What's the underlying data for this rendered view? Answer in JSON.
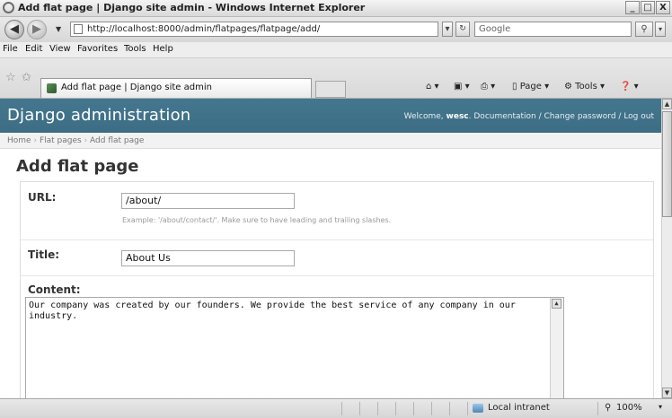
{
  "window": {
    "title": "Add flat page | Django site admin - Windows Internet Explorer",
    "controls": [
      "_",
      "□",
      "X"
    ]
  },
  "address_bar": {
    "url": "http://localhost:8000/admin/flatpages/flatpage/add/",
    "search_placeholder": "Google"
  },
  "menu": {
    "items": [
      "File",
      "Edit",
      "View",
      "Favorites",
      "Tools",
      "Help"
    ]
  },
  "tab": {
    "label": "Add flat page | Django site admin"
  },
  "command_bar": {
    "page_label": "Page",
    "tools_label": "Tools"
  },
  "django": {
    "brand": "Django administration",
    "welcome_prefix": "Welcome, ",
    "username": "wesc",
    "user_links": ". Documentation / Change password / Log out",
    "breadcrumbs": [
      "Home",
      "Flat pages",
      "Add flat page"
    ],
    "breadcrumb_sep": "›",
    "page_title": "Add flat page",
    "form": {
      "url_label": "URL:",
      "url_value": "/about/",
      "url_help": "Example: '/about/contact/'. Make sure to have leading and trailing slashes.",
      "title_label": "Title:",
      "title_value": "About Us",
      "content_label": "Content:",
      "content_value": "Our company was created by our founders. We provide the best service of any company in our industry."
    }
  },
  "status_bar": {
    "zone": "Local intranet",
    "zoom": "100%"
  }
}
